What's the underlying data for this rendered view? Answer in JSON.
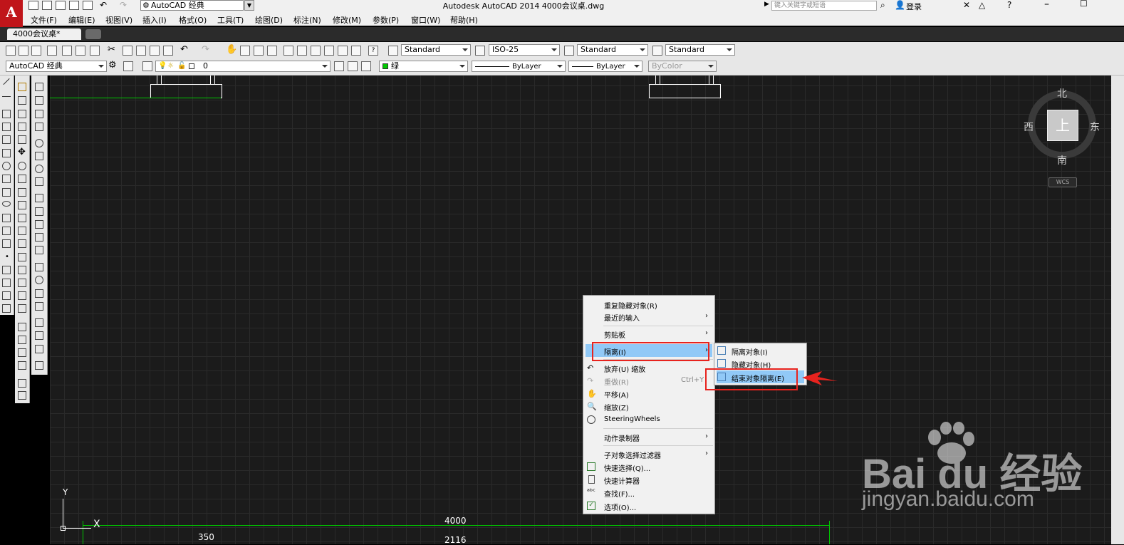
{
  "app": {
    "logo": "A",
    "title": "Autodesk AutoCAD 2014      4000会议桌.dwg",
    "workspace": "AutoCAD 经典",
    "search_placeholder": "键入关键字或短语",
    "login": "登录"
  },
  "menu": [
    "文件(F)",
    "编辑(E)",
    "视图(V)",
    "插入(I)",
    "格式(O)",
    "工具(T)",
    "绘图(D)",
    "标注(N)",
    "修改(M)",
    "参数(P)",
    "窗口(W)",
    "帮助(H)"
  ],
  "doc_tab": "4000会议桌*",
  "styles_toolbar": {
    "text_style": "Standard",
    "dim_style": "ISO-25",
    "table_style": "Standard",
    "mleader_style": "Standard"
  },
  "layers_toolbar": {
    "workspace": "AutoCAD 经典",
    "layer": "0",
    "color": "绿",
    "linetype": "ByLayer",
    "lineweight": "ByLayer",
    "plotstyle": "ByColor"
  },
  "viewcube": {
    "top_face": "上",
    "north": "北",
    "south": "南",
    "east": "东",
    "west": "西",
    "ucs": "WCS"
  },
  "drawing": {
    "dim_total": "4000",
    "dim_left": "350",
    "dim_mid": "2116",
    "ucs_x": "X",
    "ucs_y": "Y"
  },
  "context_menu": {
    "items": [
      {
        "label": "重复隐藏对象(R)"
      },
      {
        "label": "最近的输入",
        "submenu": true
      },
      {
        "label": "剪贴板",
        "submenu": true
      },
      {
        "label": "隔离(I)",
        "submenu": true,
        "highlighted": true
      },
      {
        "label": "放弃(U) 缩放"
      },
      {
        "label": "重做(R)",
        "shortcut": "Ctrl+Y",
        "disabled": true
      },
      {
        "label": "平移(A)"
      },
      {
        "label": "缩放(Z)"
      },
      {
        "label": "SteeringWheels"
      },
      {
        "label": "动作录制器",
        "submenu": true
      },
      {
        "label": "子对象选择过滤器",
        "submenu": true
      },
      {
        "label": "快速选择(Q)..."
      },
      {
        "label": "快速计算器"
      },
      {
        "label": "查找(F)..."
      },
      {
        "label": "选项(O)..."
      }
    ]
  },
  "isolate_submenu": {
    "items": [
      "隔离对象(I)",
      "隐藏对象(H)",
      "结束对象隔离(E)"
    ],
    "highlighted_index": 2
  },
  "watermark": {
    "brand": "Bai du 经验",
    "url": "jingyan.baidu.com"
  },
  "colors": {
    "accent_red": "#e8231e",
    "menu_highlight": "#91c9f7",
    "layer_green": "#00c800"
  }
}
